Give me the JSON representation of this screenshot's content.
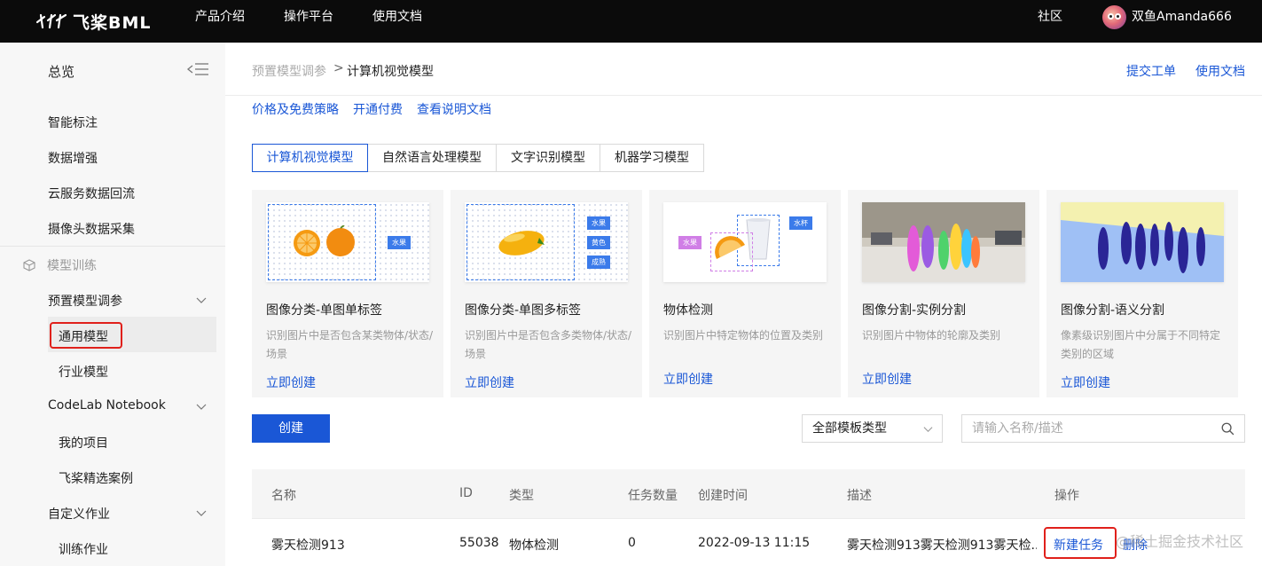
{
  "topnav": {
    "brand": "飞桨BML",
    "links": [
      "产品介绍",
      "操作平台",
      "使用文档"
    ],
    "community": "社区",
    "username": "双鱼Amanda666"
  },
  "sidebar": {
    "overview": "总览",
    "items": [
      "智能标注",
      "数据增强",
      "云服务数据回流",
      "摄像头数据采集"
    ],
    "section_model_training": "模型训练",
    "preset_group": "预置模型调参",
    "preset_children": [
      "通用模型",
      "行业模型"
    ],
    "codelab_group": "CodeLab Notebook",
    "codelab_children": [
      "我的项目",
      "飞桨精选案例"
    ],
    "custom_group": "自定义作业",
    "custom_children": [
      "训练作业"
    ]
  },
  "header": {
    "breadcrumb_prev": "预置模型调参",
    "breadcrumb_sep": ">",
    "breadcrumb_current": "计算机视觉模型",
    "submit_ticket": "提交工单",
    "docs": "使用文档"
  },
  "links": [
    "价格及免费策略",
    "开通付费",
    "查看说明文档"
  ],
  "tabs": [
    "计算机视觉模型",
    "自然语言处理模型",
    "文字识别模型",
    "机器学习模型"
  ],
  "cards": [
    {
      "title": "图像分类-单图单标签",
      "desc": "识别图片中是否包含某类物体/状态/场景",
      "link": "立即创建",
      "tags": [
        "水果"
      ]
    },
    {
      "title": "图像分类-单图多标签",
      "desc": "识别图片中是否包含多类物体/状态/场景",
      "link": "立即创建",
      "tags": [
        "水果",
        "黄色",
        "成熟"
      ]
    },
    {
      "title": "物体检测",
      "desc": "识别图片中特定物体的位置及类别",
      "link": "立即创建",
      "tags": [
        "水果",
        "水杯"
      ]
    },
    {
      "title": "图像分割-实例分割",
      "desc": "识别图片中物体的轮廓及类别",
      "link": "立即创建",
      "tags": []
    },
    {
      "title": "图像分割-语义分割",
      "desc": "像素级识别图片中分属于不同特定类别的区域",
      "link": "立即创建",
      "tags": []
    }
  ],
  "toolbar": {
    "create": "创建",
    "template_type": "全部模板类型",
    "search_placeholder": "请输入名称/描述"
  },
  "table": {
    "headers": [
      "名称",
      "ID",
      "类型",
      "任务数量",
      "创建时间",
      "描述",
      "操作"
    ],
    "rows": [
      {
        "name": "雾天检测913",
        "id": "55038",
        "type": "物体检测",
        "tasks": "0",
        "created": "2022-09-13  11:15",
        "desc": "雾天检测913雾天检测913雾天检...",
        "op_new": "新建任务",
        "op_delete": "删除"
      }
    ]
  },
  "watermark": "@稀土掘金技术社区",
  "colors": {
    "accent": "#1a57d6",
    "highlight": "#e0201b",
    "nav_bg": "#0b0b0b"
  }
}
